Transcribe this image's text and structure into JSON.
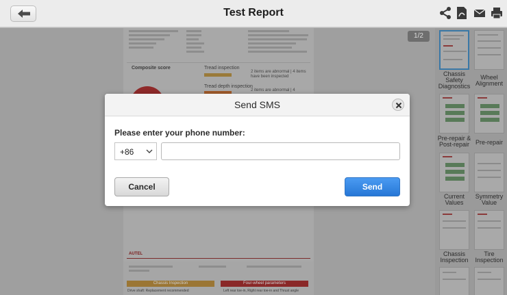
{
  "header": {
    "title": "Test Report",
    "icons": [
      "back-arrow-icon",
      "share-icon",
      "pdf-icon",
      "mail-icon",
      "print-icon"
    ]
  },
  "document": {
    "page_indicator": "1/2",
    "composite_score_label": "Composite score",
    "tread_inspection_label": "Tread inspection",
    "tread_inspection_note": "2 items are abnormal | 4 items have been inspected",
    "tread_depth_label": "Tread depth inspection",
    "tread_depth_note": "2 items are abnormal | 4",
    "footer_brand": "AUTEL",
    "chassis_inspection": "Chassis Inspection",
    "four_wheel_parameters": "Four-wheel parameters",
    "chassis_note": "Drive shaft: Replacement recommended",
    "four_wheel_note": "Left rear toe-in, Right rear toe-in and Thrust angle"
  },
  "thumbnails": [
    {
      "label": "Chassis Safety Diagnostics",
      "selected": true
    },
    {
      "label": "Wheel Alignment",
      "selected": false
    },
    {
      "label": "Pre-repair & Post-repair",
      "selected": false
    },
    {
      "label": "Pre-repair",
      "selected": false
    },
    {
      "label": "Current Values",
      "selected": false
    },
    {
      "label": "Symmetry Value",
      "selected": false
    },
    {
      "label": "Chassis Inspection",
      "selected": false
    },
    {
      "label": "Tire Inspection",
      "selected": false
    }
  ],
  "dialog": {
    "title": "Send SMS",
    "prompt": "Please enter your phone number:",
    "country_code": "+86",
    "phone_value": "",
    "cancel_label": "Cancel",
    "send_label": "Send"
  },
  "colors": {
    "send_button": "#2f7fe0",
    "selected_thumbnail_border": "#3a78a6",
    "chassis_section": "#c8a04a",
    "four_wheel_section": "#b83232"
  }
}
